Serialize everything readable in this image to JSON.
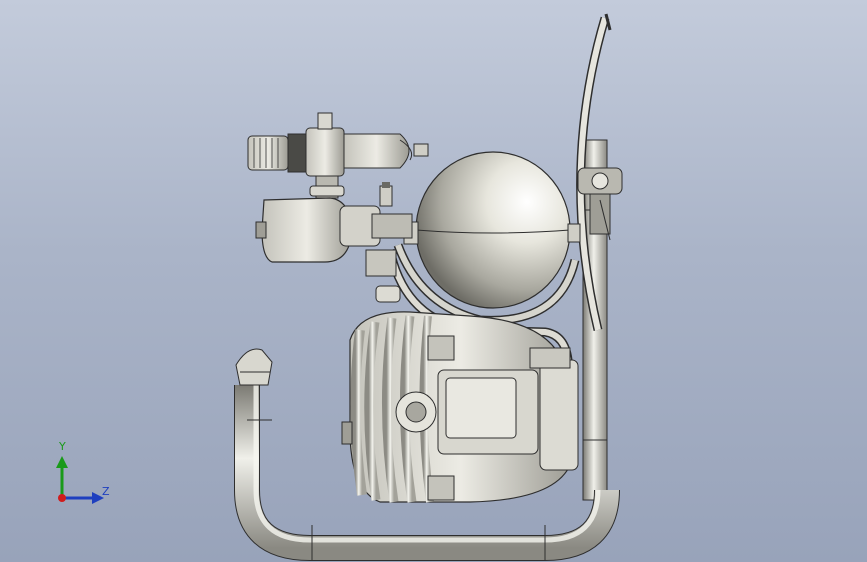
{
  "viewport": {
    "background_top": "#c3cbdb",
    "background_bottom": "#98a3ba",
    "model_name": "air-compressor-side-view"
  },
  "triad": {
    "y_label": "Y",
    "z_label": "Z",
    "y_color": "#1a9a1a",
    "z_color": "#1e3fbf",
    "x_color": "#d01c1c"
  },
  "colors": {
    "metal_light": "#f0f0ea",
    "metal_mid": "#c9c8c0",
    "metal_dark": "#7b7a73",
    "edge": "#2e2e2e"
  }
}
